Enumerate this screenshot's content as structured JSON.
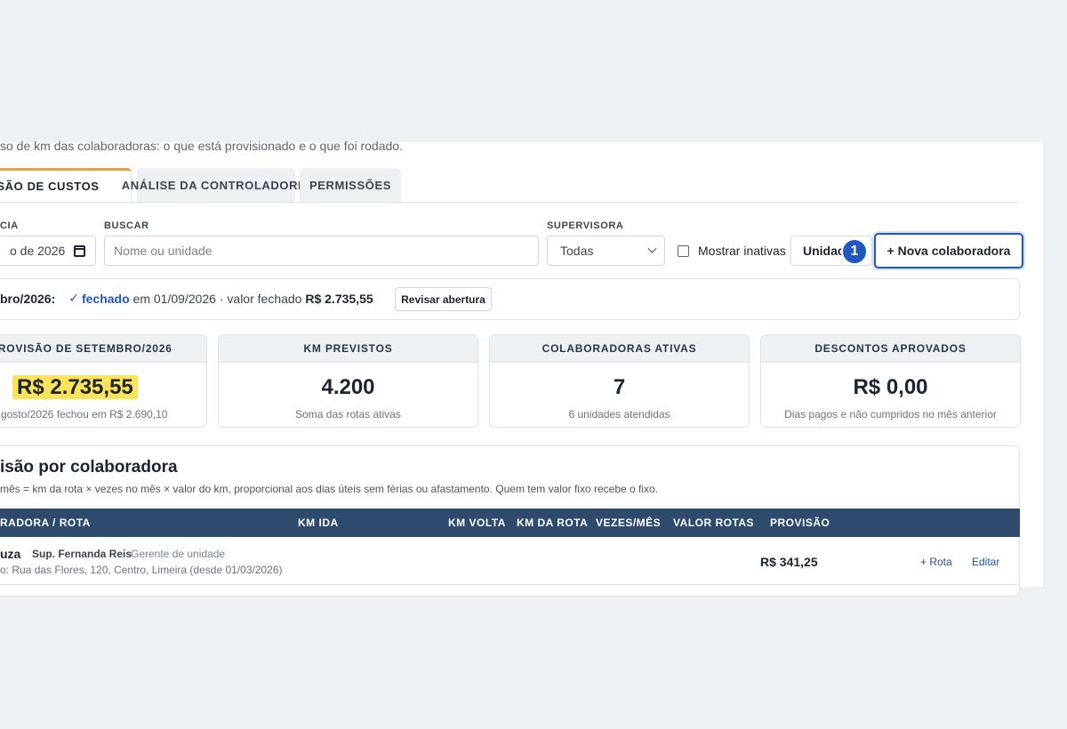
{
  "header": {
    "subtitle": "so de km das colaboradoras: o que está provisionado e o que foi rodado."
  },
  "tabs": [
    {
      "label": "SÃO DE CUSTOS",
      "active": true
    },
    {
      "label": "ANÁLISE DA CONTROLADORIA",
      "active": false
    },
    {
      "label": "PERMISSÕES",
      "active": false
    }
  ],
  "filters": {
    "competencia": {
      "label": "CIA",
      "value": "o de 2026"
    },
    "buscar": {
      "label": "BUSCAR",
      "placeholder": "Nome ou unidade"
    },
    "supervisora": {
      "label": "SUPERVISORA",
      "value": "Todas"
    },
    "mostrar_inativas": {
      "label": "Mostrar inativas",
      "checked": false
    },
    "unidade_button": "Unidac",
    "step_badge": "1",
    "nova_button": "+ Nova colaboradora"
  },
  "status": {
    "period": "bro/2026:",
    "check": "✓",
    "state": "fechado",
    "detail": " em 01/09/2026 · valor fechado ",
    "amount": "R$ 2.735,55",
    "review_button": "Revisar abertura"
  },
  "cards": [
    {
      "title": "PROVISÃO DE SETEMBRO/2026",
      "value": "R$ 2.735,55",
      "sub": "gosto/2026 fechou em R$ 2.690,10"
    },
    {
      "title": "KM PREVISTOS",
      "value": "4.200",
      "sub": "Soma das rotas ativas"
    },
    {
      "title": "COLABORADORAS ATIVAS",
      "value": "7",
      "sub": "6 unidades atendidas"
    },
    {
      "title": "DESCONTOS APROVADOS",
      "value": "R$ 0,00",
      "sub": "Dias pagos e não cumpridos no mês anterior"
    }
  ],
  "provision": {
    "title": "isão por colaboradora",
    "description": "mês = km da rota × vezes no mês × valor do km, proporcional aos dias úteis sem férias ou afastamento. Quem tem valor fixo recebe o fixo.",
    "columns": [
      "RADORA / ROTA",
      "KM IDA",
      "KM VOLTA",
      "KM DA ROTA",
      "VEZES/MÊS",
      "VALOR ROTAS",
      "PROVISÃO"
    ],
    "rows": [
      {
        "name": "uza",
        "supervisor": "Sup. Fernanda Reis",
        "role": "Gerente de unidade",
        "address": "o: Rua das Flores, 120, Centro, Limeira (desde 01/03/2026)",
        "provisao": "R$ 341,25",
        "add_route": "+ Rota",
        "edit": "Editar"
      }
    ]
  },
  "colors": {
    "accent": "#1f57c3",
    "tab_active_border": "#e6a23c",
    "table_header": "#2e4a6d",
    "highlight": "#fbe45a"
  }
}
